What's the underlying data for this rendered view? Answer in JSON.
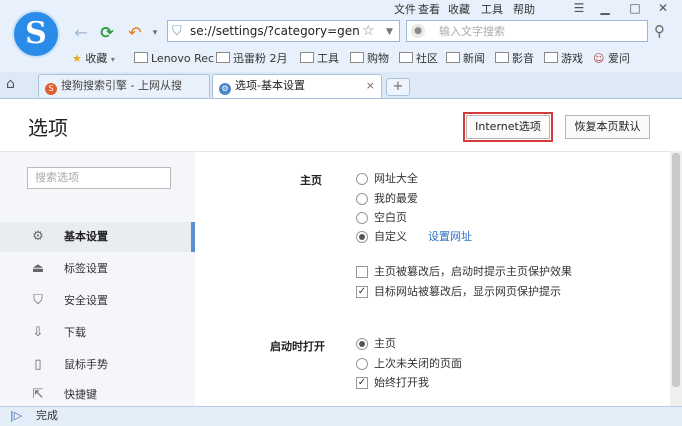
{
  "menu": {
    "file": "文件",
    "view": "查看",
    "favorites": "收藏",
    "tools": "工具",
    "help": "帮助"
  },
  "address": {
    "url": "se://settings/?category=gen"
  },
  "search": {
    "placeholder": "输入文字搜索"
  },
  "bookmarks": [
    {
      "label": "收藏",
      "icon": "star-icon"
    },
    {
      "label": "Lenovo Rec",
      "icon": "folder-icon"
    },
    {
      "label": "迅雷粉 2月",
      "icon": "folder-icon"
    },
    {
      "label": "工具",
      "icon": "folder-icon"
    },
    {
      "label": "购物",
      "icon": "folder-icon"
    },
    {
      "label": "社区",
      "icon": "folder-icon"
    },
    {
      "label": "新闻",
      "icon": "folder-icon"
    },
    {
      "label": "影音",
      "icon": "folder-icon"
    },
    {
      "label": "游戏",
      "icon": "folder-icon"
    },
    {
      "label": "爱问",
      "icon": "person-icon"
    }
  ],
  "tabs": [
    {
      "label": "搜狗搜索引擎 - 上网从搜",
      "active": false
    },
    {
      "label": "选项-基本设置",
      "active": true
    }
  ],
  "page": {
    "title": "选项",
    "internet_button": "Internet选项",
    "reset_button": "恢复本页默认"
  },
  "sidebar": {
    "search_placeholder": "搜索选项",
    "items": [
      {
        "label": "基本设置",
        "icon": "gear-icon",
        "active": true
      },
      {
        "label": "标签设置",
        "icon": "tab-icon",
        "active": false
      },
      {
        "label": "安全设置",
        "icon": "shield-icon",
        "active": false
      },
      {
        "label": "下载",
        "icon": "download-icon",
        "active": false
      },
      {
        "label": "鼠标手势",
        "icon": "mouse-icon",
        "active": false
      },
      {
        "label": "快捷键",
        "icon": "shortcut-icon",
        "active": false
      }
    ]
  },
  "homepage": {
    "section_label": "主页",
    "options": [
      "网址大全",
      "我的最爱",
      "空白页",
      "自定义"
    ],
    "selected": "自定义",
    "set_url_link": "设置网址",
    "checks": [
      {
        "label": "主页被篡改后，启动时提示主页保护效果",
        "checked": false
      },
      {
        "label": "目标网站被篡改后，显示网页保护提示",
        "checked": true
      }
    ]
  },
  "startup": {
    "section_label": "启动时打开",
    "options": [
      "主页",
      "上次未关闭的页面"
    ],
    "selected": "主页",
    "check": {
      "label": "始终打开我",
      "checked": true
    }
  },
  "status": {
    "text": "完成"
  },
  "colors": {
    "accent": "#2a8be8",
    "highlight_border": "#d43a3a",
    "link": "#2f6fc4"
  }
}
